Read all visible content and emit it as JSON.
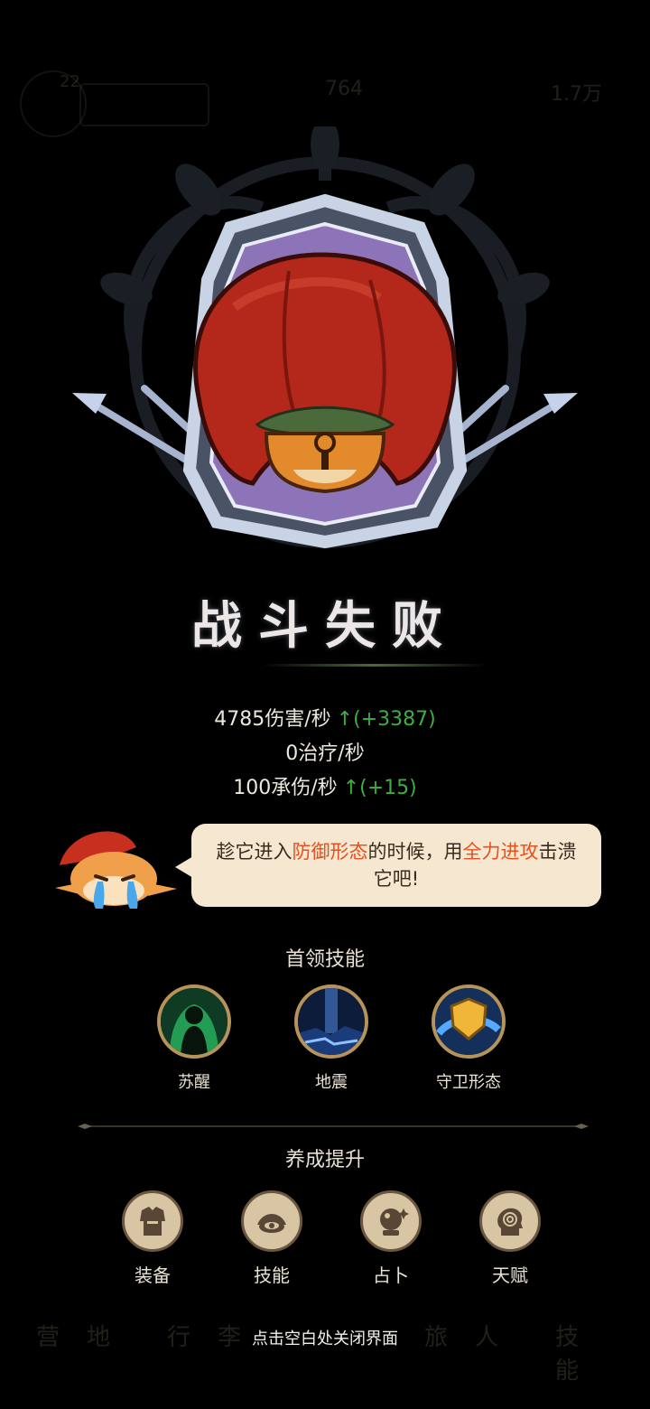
{
  "result": {
    "title": "战斗失败"
  },
  "stats": [
    {
      "value": "4785伤害/秒",
      "change": "↑(+3387)"
    },
    {
      "value": "0治疗/秒",
      "change": ""
    },
    {
      "value": "100承伤/秒",
      "change": "↑(+15)"
    }
  ],
  "hint": {
    "parts": [
      {
        "text": "趁它进入",
        "highlight": false
      },
      {
        "text": "防御形态",
        "highlight": true
      },
      {
        "text": "的时候，用",
        "highlight": false
      },
      {
        "text": "全力进攻",
        "highlight": true
      },
      {
        "text": "击溃它吧!",
        "highlight": false
      }
    ]
  },
  "boss_skills": {
    "title": "首领技能",
    "items": [
      {
        "label": "苏醒",
        "icon": "awaken-icon"
      },
      {
        "label": "地震",
        "icon": "earthquake-icon"
      },
      {
        "label": "守卫形态",
        "icon": "guard-form-icon"
      }
    ]
  },
  "growth": {
    "title": "养成提升",
    "items": [
      {
        "label": "装备",
        "icon": "armor-icon"
      },
      {
        "label": "技能",
        "icon": "eye-helmet-icon"
      },
      {
        "label": "占卜",
        "icon": "crystal-ball-icon"
      },
      {
        "label": "天赋",
        "icon": "talent-head-icon"
      }
    ]
  },
  "footer": {
    "close_hint": "点击空白处关闭界面"
  },
  "background_hud": {
    "level": "22",
    "resource_1": "764",
    "resource_2": "1.7万",
    "tabs": [
      "营地",
      "行李",
      "旅人",
      "技能"
    ]
  },
  "colors": {
    "highlight": "#e8501f",
    "stat_up": "#3fae3f",
    "ring_gold": "#b69459",
    "bubble": "#f6e7d0"
  }
}
